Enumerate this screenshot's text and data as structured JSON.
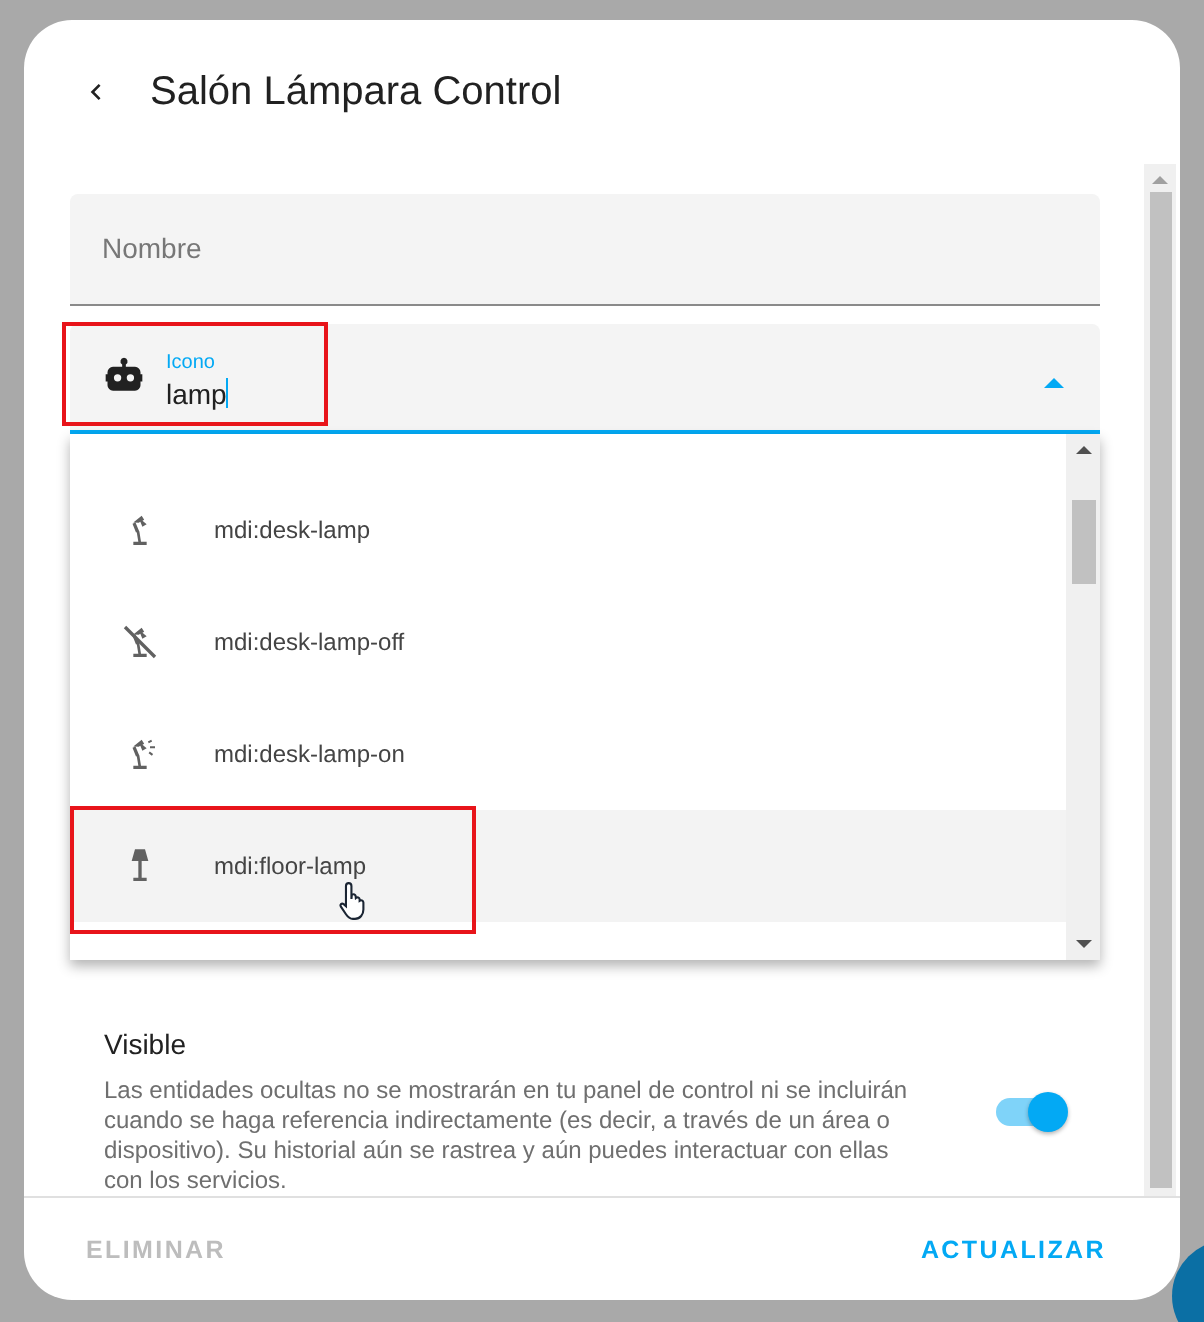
{
  "dialog": {
    "title": "Salón Lámpara Control"
  },
  "fields": [
    {
      "kind": "text",
      "label": "Nombre",
      "focused": false
    },
    {
      "kind": "icon",
      "label": "Icono",
      "value": "lamp",
      "focused": true
    }
  ],
  "dropdown": {
    "expanded": true,
    "items": [
      {
        "kind": "desk-lamp",
        "label": "mdi:desk-lamp",
        "selected": false
      },
      {
        "kind": "desk-lamp-off",
        "label": "mdi:desk-lamp-off",
        "selected": false
      },
      {
        "kind": "desk-lamp-on",
        "label": "mdi:desk-lamp-on",
        "selected": false
      },
      {
        "kind": "floor-lamp",
        "label": "mdi:floor-lamp",
        "selected": true
      }
    ]
  },
  "visible": {
    "title": "Visible",
    "description": "Las entidades ocultas no se mostrarán en tu panel de control ni se incluirán cuando se haga referencia indirectamente (es decir, a través de un área o dispositivo). Su historial aún se rastrea y aún puedes interactuar con ellas con los servicios.",
    "on": true
  },
  "buttons": [
    {
      "label": "ELIMINAR",
      "disabled": true
    },
    {
      "label": "ACTUALIZAR",
      "disabled": false
    }
  ]
}
